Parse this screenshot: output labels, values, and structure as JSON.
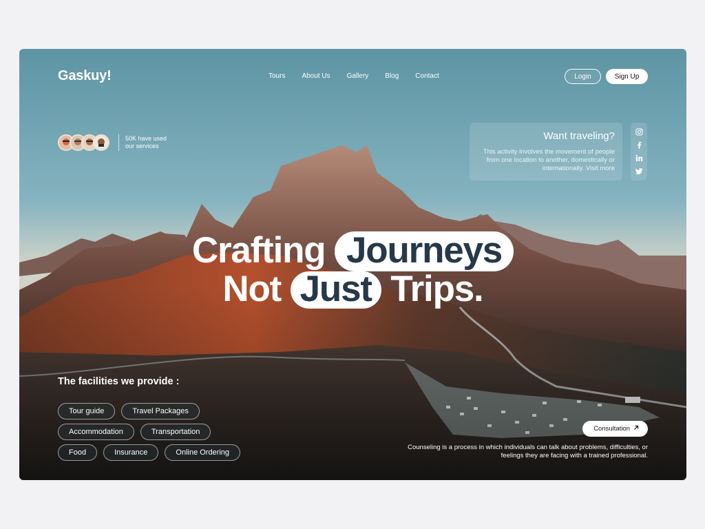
{
  "brand": {
    "logo": "Gaskuy!"
  },
  "nav": {
    "items": [
      "Tours",
      "About Us",
      "Gallery",
      "Blog",
      "Contact"
    ]
  },
  "auth": {
    "login": "Login",
    "signup": "Sign Up"
  },
  "users": {
    "text": "50K have used our services"
  },
  "info": {
    "title": "Want traveling?",
    "body": "This activity involves the movement of people from one location to another, domestically or internationally. Visit more"
  },
  "social": {
    "icons": [
      "instagram-icon",
      "facebook-icon",
      "linkedin-icon",
      "twitter-icon"
    ]
  },
  "headline": {
    "line1_plain": "Crafting",
    "line1_pill": "Journeys",
    "line2_plain_a": "Not",
    "line2_pill": "Just",
    "line2_plain_b": "Trips."
  },
  "facilities": {
    "title": "The facilities we provide :",
    "tags": [
      "Tour guide",
      "Travel Packages",
      "Accommodation",
      "Transportation",
      "Food",
      "Insurance",
      "Online Ordering"
    ]
  },
  "consultation": {
    "button": "Consultation",
    "text": "Counseling is a process in which individuals can talk about problems, difficulties, or feelings they are facing with a trained professional."
  },
  "colors": {
    "pill_text": "#26384a",
    "sky_top": "#5d94a3",
    "sky_bottom": "#cfd3c8"
  }
}
